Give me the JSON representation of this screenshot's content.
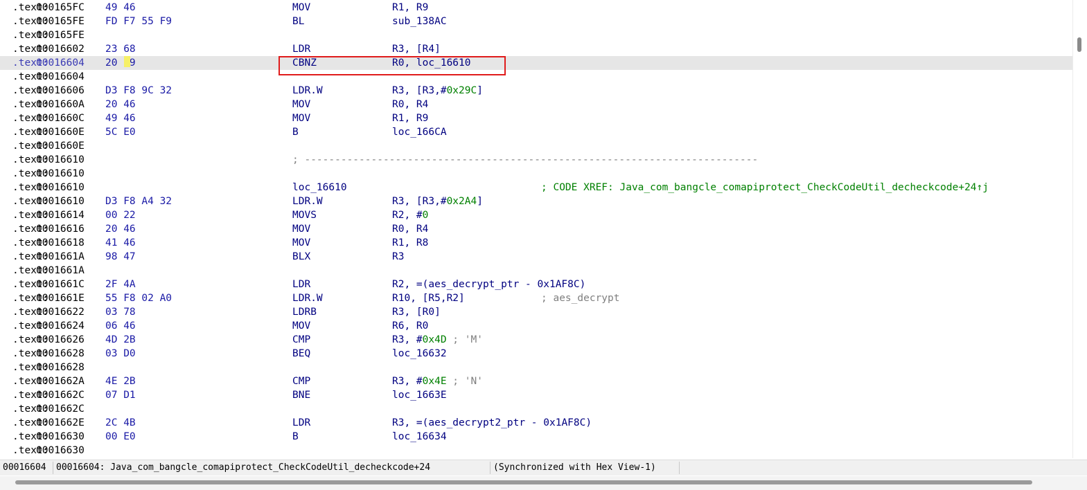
{
  "listing": {
    "lines": [
      {
        "seg": ".text:",
        "addr": "000165FC",
        "bytes": "49 46",
        "mnem": "MOV",
        "ops": [
          [
            "R1, R9",
            ""
          ]
        ]
      },
      {
        "seg": ".text:",
        "addr": "000165FE",
        "bytes": "FD F7 55 F9",
        "mnem": "BL",
        "ops": [
          [
            "sub_138AC",
            ""
          ]
        ]
      },
      {
        "seg": ".text:",
        "addr": "000165FE"
      },
      {
        "seg": ".text:",
        "addr": "00016602",
        "bytes": "23 68",
        "mnem": "LDR",
        "ops": [
          [
            "R3, [R4]",
            ""
          ]
        ]
      },
      {
        "seg": ".text:",
        "addr": "00016604",
        "bytes": "20 B9",
        "mnem": "CBNZ",
        "ops": [
          [
            "R0, loc_16610",
            ""
          ]
        ],
        "current": true
      },
      {
        "seg": ".text:",
        "addr": "00016604"
      },
      {
        "seg": ".text:",
        "addr": "00016606",
        "bytes": "D3 F8 9C 32",
        "mnem": "LDR.W",
        "ops": [
          [
            "R3, [R3,#",
            ""
          ],
          [
            "0x29C",
            "num"
          ],
          [
            "]",
            ""
          ]
        ]
      },
      {
        "seg": ".text:",
        "addr": "0001660A",
        "bytes": "20 46",
        "mnem": "MOV",
        "ops": [
          [
            "R0, R4",
            ""
          ]
        ]
      },
      {
        "seg": ".text:",
        "addr": "0001660C",
        "bytes": "49 46",
        "mnem": "MOV",
        "ops": [
          [
            "R1, R9",
            ""
          ]
        ]
      },
      {
        "seg": ".text:",
        "addr": "0001660E",
        "bytes": "5C E0",
        "mnem": "B",
        "ops": [
          [
            "loc_166CA",
            ""
          ]
        ]
      },
      {
        "seg": ".text:",
        "addr": "0001660E"
      },
      {
        "seg": ".text:",
        "addr": "00016610",
        "sep": "; ---------------------------------------------------------------------------"
      },
      {
        "seg": ".text:",
        "addr": "00016610"
      },
      {
        "seg": ".text:",
        "addr": "00016610",
        "mnem": "loc_16610",
        "xref": "; CODE XREF: Java_com_bangcle_comapiprotect_CheckCodeUtil_decheckcode+24↑j"
      },
      {
        "seg": ".text:",
        "addr": "00016610",
        "bytes": "D3 F8 A4 32",
        "mnem": "LDR.W",
        "ops": [
          [
            "R3, [R3,#",
            ""
          ],
          [
            "0x2A4",
            "num"
          ],
          [
            "]",
            ""
          ]
        ]
      },
      {
        "seg": ".text:",
        "addr": "00016614",
        "bytes": "00 22",
        "mnem": "MOVS",
        "ops": [
          [
            "R2, #",
            ""
          ],
          [
            "0",
            "num"
          ]
        ]
      },
      {
        "seg": ".text:",
        "addr": "00016616",
        "bytes": "20 46",
        "mnem": "MOV",
        "ops": [
          [
            "R0, R4",
            ""
          ]
        ]
      },
      {
        "seg": ".text:",
        "addr": "00016618",
        "bytes": "41 46",
        "mnem": "MOV",
        "ops": [
          [
            "R1, R8",
            ""
          ]
        ]
      },
      {
        "seg": ".text:",
        "addr": "0001661A",
        "bytes": "98 47",
        "mnem": "BLX",
        "ops": [
          [
            "R3",
            ""
          ]
        ]
      },
      {
        "seg": ".text:",
        "addr": "0001661A"
      },
      {
        "seg": ".text:",
        "addr": "0001661C",
        "bytes": "2F 4A",
        "mnem": "LDR",
        "ops": [
          [
            "R2, =(aes_decrypt_ptr - ",
            ""
          ],
          [
            "0x1AF8C",
            ""
          ],
          [
            ")",
            ""
          ]
        ]
      },
      {
        "seg": ".text:",
        "addr": "0001661E",
        "bytes": "55 F8 02 A0",
        "mnem": "LDR.W",
        "ops": [
          [
            "R10, [R5,R2]",
            ""
          ]
        ],
        "cmt": "; aes_decrypt"
      },
      {
        "seg": ".text:",
        "addr": "00016622",
        "bytes": "03 78",
        "mnem": "LDRB",
        "ops": [
          [
            "R3, [R0]",
            ""
          ]
        ]
      },
      {
        "seg": ".text:",
        "addr": "00016624",
        "bytes": "06 46",
        "mnem": "MOV",
        "ops": [
          [
            "R6, R0",
            ""
          ]
        ]
      },
      {
        "seg": ".text:",
        "addr": "00016626",
        "bytes": "4D 2B",
        "mnem": "CMP",
        "ops": [
          [
            "R3, #",
            ""
          ],
          [
            "0x4D",
            "num"
          ],
          [
            " ; 'M'",
            "chr"
          ]
        ]
      },
      {
        "seg": ".text:",
        "addr": "00016628",
        "bytes": "03 D0",
        "mnem": "BEQ",
        "ops": [
          [
            "loc_16632",
            ""
          ]
        ]
      },
      {
        "seg": ".text:",
        "addr": "00016628"
      },
      {
        "seg": ".text:",
        "addr": "0001662A",
        "bytes": "4E 2B",
        "mnem": "CMP",
        "ops": [
          [
            "R3, #",
            ""
          ],
          [
            "0x4E",
            "num"
          ],
          [
            " ; 'N'",
            "chr"
          ]
        ]
      },
      {
        "seg": ".text:",
        "addr": "0001662C",
        "bytes": "07 D1",
        "mnem": "BNE",
        "ops": [
          [
            "loc_1663E",
            ""
          ]
        ]
      },
      {
        "seg": ".text:",
        "addr": "0001662C"
      },
      {
        "seg": ".text:",
        "addr": "0001662E",
        "bytes": "2C 4B",
        "mnem": "LDR",
        "ops": [
          [
            "R3, =(aes_decrypt2_ptr - ",
            ""
          ],
          [
            "0x1AF8C",
            ""
          ],
          [
            ")",
            ""
          ]
        ]
      },
      {
        "seg": ".text:",
        "addr": "00016630",
        "bytes": "00 E0",
        "mnem": "B",
        "ops": [
          [
            "loc_16634",
            ""
          ]
        ]
      },
      {
        "seg": ".text:",
        "addr": "00016630"
      }
    ]
  },
  "status_bar": {
    "offset": "00016604",
    "location": "00016604: Java_com_bangcle_comapiprotect_CheckCodeUtil_decheckcode+24",
    "sync": "(Synchronized with Hex View-1)"
  },
  "colors": {
    "address": "#000000",
    "current_address": "#3a3ab4",
    "bytes": "#1a1aa6",
    "mnemonic": "#000080",
    "numeric": "#008000",
    "comment": "#7f7f7f",
    "xref": "#008000",
    "current_line_bg": "#e6e6e6",
    "highlight_box": "#e01b1b"
  }
}
